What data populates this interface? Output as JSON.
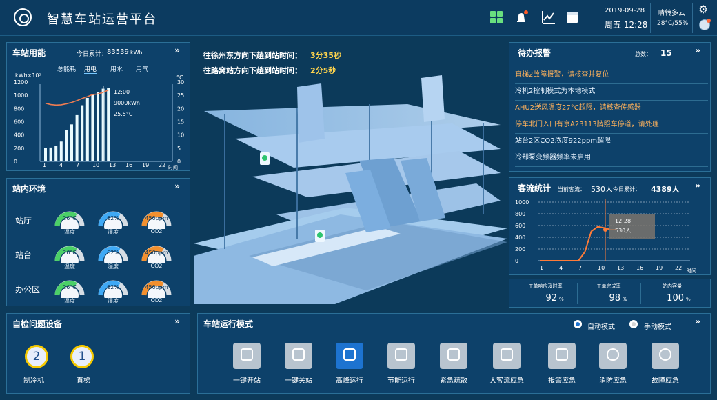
{
  "header": {
    "title": "智慧车站运营平台",
    "date": "2019-09-28",
    "time": "周五 12:28",
    "weather": "晴转多云",
    "temperature": "28°C/55%"
  },
  "energy": {
    "title": "车站用能",
    "today_total_label": "今日累计：",
    "today_total_value": "83539",
    "today_total_unit": "kWh",
    "tabs": [
      "总能耗",
      "用电",
      "用水",
      "用气"
    ],
    "active_tab": "用电",
    "left_axis_unit": "kWh×10³",
    "right_axis_unit": "°C",
    "tooltip_time": "12:00",
    "tooltip_energy": "9000kWh",
    "tooltip_temp": "25.5°C",
    "x_label": "时间"
  },
  "environment": {
    "title": "站内环境",
    "rows": [
      {
        "name": "站厅",
        "temp": "26°C",
        "humidity": "62%",
        "co2": "450ppm"
      },
      {
        "name": "站台",
        "temp": "26°C",
        "humidity": "62%",
        "co2": "450ppm"
      },
      {
        "name": "办公区",
        "temp": "26°C",
        "humidity": "62%",
        "co2": "450ppm"
      }
    ],
    "labels": {
      "temp": "温度",
      "humidity": "湿度",
      "co2": "CO2"
    }
  },
  "self_check": {
    "title": "自检问题设备",
    "items": [
      {
        "count": "2",
        "label": "制冷机"
      },
      {
        "count": "1",
        "label": "直梯"
      }
    ]
  },
  "arrivals": [
    {
      "label": "往徐州东方向下趟到站时间：",
      "value": "3分35秒"
    },
    {
      "label": "往路窝站方向下趟到站时间：",
      "value": "2分5秒"
    }
  ],
  "alarms": {
    "title": "待办报警",
    "total_label": "总数：",
    "total_value": "15",
    "items": [
      {
        "text": "直梯2故障报警，请核查并复位",
        "color": "orange"
      },
      {
        "text": "冷机2控制模式为本地模式",
        "color": "white"
      },
      {
        "text": "AHU2送风温度27°C超限，请核查传感器",
        "color": "orange"
      },
      {
        "text": "停车北门入口有京A23113牌照车停道，请处理",
        "color": "orange"
      },
      {
        "text": "站台2区CO2浓度922ppm超限",
        "color": "white"
      },
      {
        "text": "冷却泵变频器频率未启用",
        "color": "white"
      }
    ]
  },
  "passenger": {
    "title": "客流统计",
    "current_label": "当前客流：",
    "current_value": "530人",
    "today_label": "今日累计：",
    "today_value": "4389人",
    "tooltip_time": "12:28",
    "tooltip_value": "530人",
    "x_label": "时间"
  },
  "kpis": [
    {
      "label": "工单响应及时率",
      "value": "92",
      "unit": "%"
    },
    {
      "label": "工单完成率",
      "value": "98",
      "unit": "%"
    },
    {
      "label": "站内客量",
      "value": "100",
      "unit": "%"
    }
  ],
  "modes": {
    "title": "车站运行模式",
    "radio_auto": "自动模式",
    "radio_manual": "手动模式",
    "buttons": [
      {
        "label": "一键开站",
        "icon": "pulse-icon"
      },
      {
        "label": "一键关站",
        "icon": "close-box-icon"
      },
      {
        "label": "高峰运行",
        "icon": "people-up-icon"
      },
      {
        "label": "节能运行",
        "icon": "leaf-icon"
      },
      {
        "label": "紧急疏散",
        "icon": "crowd-icon"
      },
      {
        "label": "大客流应急",
        "icon": "location-people-icon"
      },
      {
        "label": "报警应急",
        "icon": "info-icon"
      },
      {
        "label": "消防应急",
        "icon": "fire-icon"
      },
      {
        "label": "故障应急",
        "icon": "prohibit-icon"
      }
    ]
  },
  "chart_data": [
    {
      "type": "bar",
      "title": "车站用能",
      "xlabel": "时间",
      "ylabel": "kWh×10³",
      "categories": [
        1,
        2,
        3,
        4,
        5,
        6,
        7,
        8,
        9,
        10,
        11,
        12,
        13
      ],
      "series": [
        {
          "name": "用电",
          "values": [
            200,
            210,
            230,
            300,
            480,
            560,
            700,
            850,
            960,
            1020,
            1050,
            1100,
            1110
          ]
        },
        {
          "name": "温度",
          "values": [
            22,
            21.5,
            21.3,
            21.4,
            21.8,
            22.3,
            23,
            23.8,
            24.5,
            25.3,
            25.5,
            26.1,
            27
          ]
        }
      ],
      "ylim": [
        0,
        1200
      ],
      "y2lim": [
        0,
        30
      ],
      "x_ticks": [
        "1",
        "4",
        "7",
        "10",
        "13",
        "16",
        "19",
        "22"
      ],
      "y_ticks": [
        "0",
        "200",
        "400",
        "600",
        "800",
        "1000",
        "1200"
      ],
      "y2_ticks": [
        "0",
        "5",
        "10",
        "15",
        "20",
        "25",
        "30"
      ]
    },
    {
      "type": "line",
      "title": "客流统计",
      "xlabel": "时间",
      "x": [
        1,
        4,
        7,
        8,
        9,
        10,
        11,
        12,
        13
      ],
      "values": [
        0,
        0,
        0,
        150,
        500,
        580,
        560,
        530,
        530
      ],
      "ylim": [
        0,
        1000
      ],
      "x_ticks": [
        "1",
        "4",
        "7",
        "10",
        "13",
        "16",
        "19",
        "22"
      ],
      "y_ticks": [
        "0",
        "200",
        "400",
        "600",
        "800",
        "1000"
      ]
    }
  ]
}
